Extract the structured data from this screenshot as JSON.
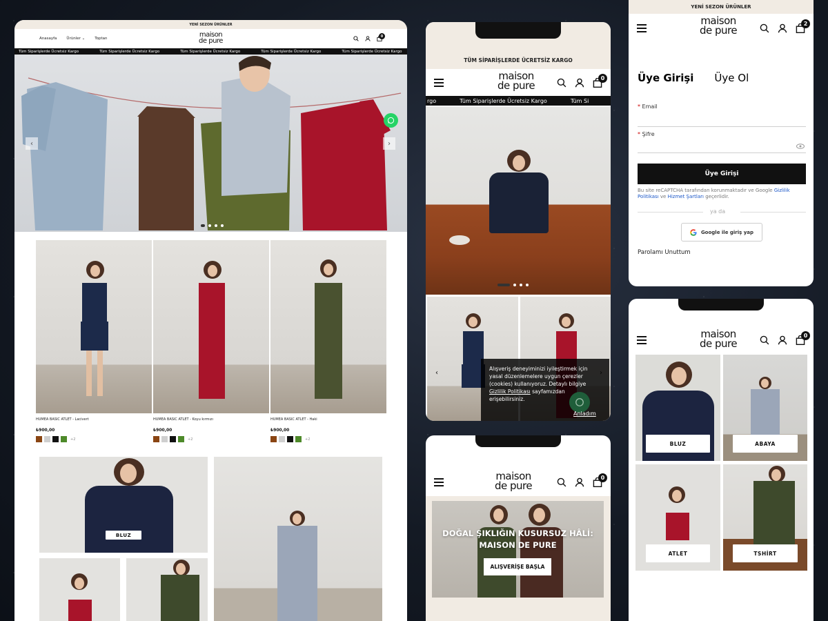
{
  "colors": {
    "black": "#111111",
    "cream": "#f1ebe3",
    "whatsapp": "#25d366",
    "link_blue": "#1a56c7"
  },
  "icons": [
    "search-icon",
    "user-icon",
    "bag-icon",
    "hamburger-icon",
    "whatsapp-icon",
    "google-icon",
    "eye-icon",
    "chevron-left-icon",
    "chevron-right-icon"
  ],
  "brand": {
    "line1": "maison",
    "line2": "de pure"
  },
  "desktop": {
    "topbar": "YENİ SEZON ÜRÜNLER",
    "menu": [
      "Anasayfa",
      "Ürünler",
      "Toptan"
    ],
    "cart_count": "0",
    "marquee": [
      "Tüm Siparişlerde Ücretsiz Kargo",
      "Tüm Siparişlerde Ücretsiz Kargo",
      "Tüm Siparişlerde Ücretsiz Kargo",
      "Tüm Siparişlerde Ücretsiz Kargo",
      "Tüm Siparişlerde Ücretsiz Kargo"
    ],
    "products": [
      {
        "name": "HUMEA BASIC ATLET - Lacivert",
        "price": "₺900,00",
        "swatches": [
          "#8a4513",
          "#cfcfcf",
          "#111111",
          "#4e8a2a"
        ],
        "more": "+2"
      },
      {
        "name": "HUMEA BASIC ATLET - Koyu kırmızı",
        "price": "₺900,00",
        "swatches": [
          "#8a4513",
          "#cfcfcf",
          "#111111",
          "#4e8a2a"
        ],
        "more": "+2"
      },
      {
        "name": "HUMEA BASIC ATLET - Haki",
        "price": "₺900,00",
        "swatches": [
          "#8a4513",
          "#cfcfcf",
          "#111111",
          "#4e8a2a"
        ],
        "more": "+2"
      }
    ],
    "category_label": "BLUZ"
  },
  "mobile_home": {
    "shipping": "TÜM SİPARİŞLERDE ÜCRETSİZ KARGO",
    "cart_count": "0",
    "marquee": [
      "rgo",
      "Tüm Siparişlerde Ücretsiz Kargo",
      "Tüm Si"
    ],
    "cookie_text": "Alışveriş deneyiminizi iyileştirmek için yasal düzenlemelere uygun çerezler (cookies) kullanıyoruz. Detaylı bilgiye",
    "cookie_link": "Gizlilik Politikası",
    "cookie_tail": "sayfamızdan erişebilirsiniz.",
    "cookie_accept": "Anladım"
  },
  "login": {
    "topbar": "YENİ SEZON ÜRÜNLER",
    "cart_count": "2",
    "tab_login": "Üye Girişi",
    "tab_register": "Üye Ol",
    "email_label": "Email",
    "password_label": "Şifre",
    "submit": "Üye Girişi",
    "recaptcha_pre": "Bu site reCAPTCHA tarafından korunmaktadır ve Google",
    "privacy": "Gizlilik Politikası",
    "and": "ve",
    "terms": "Hizmet Şartları",
    "recaptcha_post": "geçerlidir.",
    "or": "ya da",
    "google": "Google ile giriş yap",
    "forgot": "Parolamı Unuttum"
  },
  "categories": {
    "cart_count": "0",
    "items": [
      "BLUZ",
      "ABAYA",
      "ATLET",
      "TSHİRT"
    ]
  },
  "banner": {
    "cart_count": "0",
    "title_line1": "DOĞAL ŞIKLIĞIN KUSURSUZ HÂLİ:",
    "title_line2": "MAISON DE PURE",
    "cta": "ALIŞVERİŞE BAŞLA"
  }
}
